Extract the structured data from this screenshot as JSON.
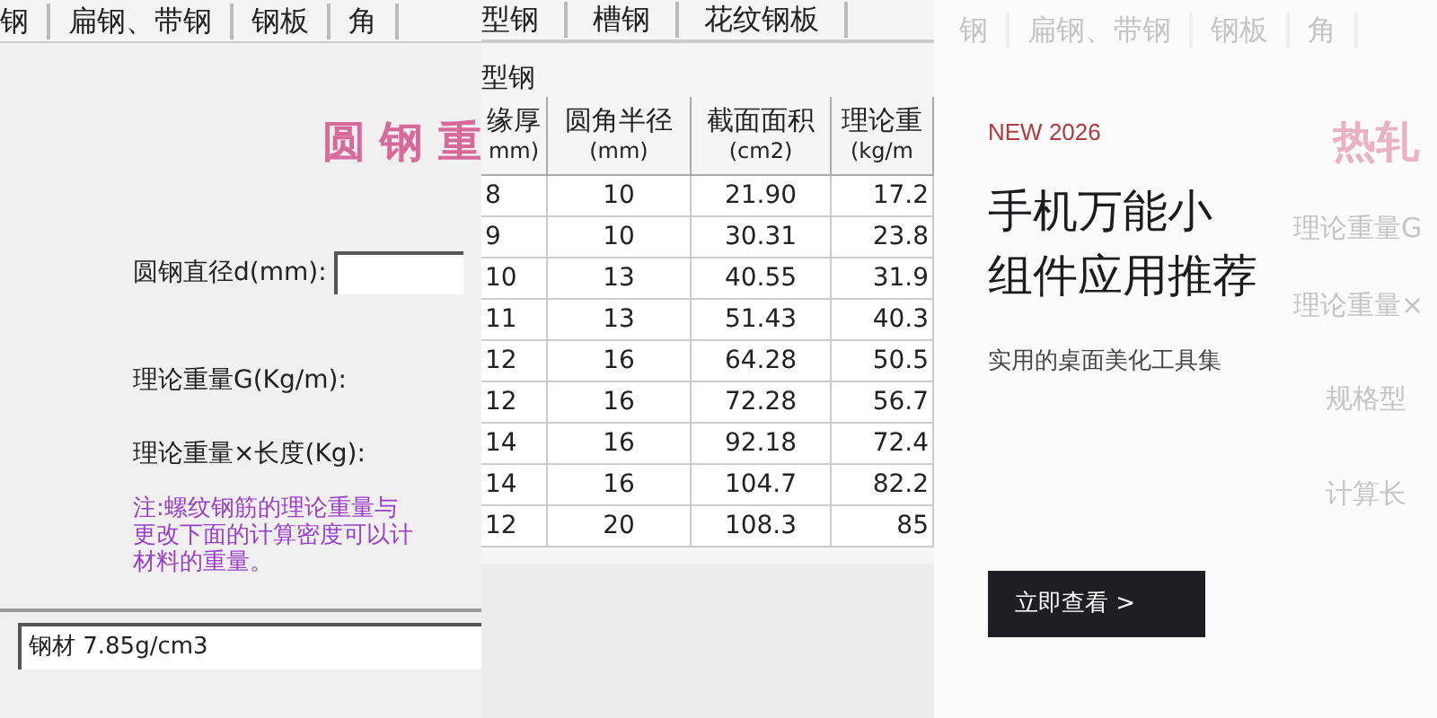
{
  "calculator": {
    "tabs": [
      "钢",
      "扁钢、带钢",
      "钢板",
      "角"
    ],
    "title": "圆 钢 重",
    "diameter_label": "圆钢直径d(mm):",
    "weight_label": "理论重量G(Kg/m):",
    "total_label": "理论重量×长度(Kg):",
    "note": [
      "注:螺纹钢筋的理论重量与",
      "更改下面的计算密度可以计",
      "材料的重量。"
    ],
    "density": "钢材 7.85g/cm3"
  },
  "table_panel": {
    "tabs": [
      "型钢",
      "槽钢",
      "花纹钢板"
    ],
    "section": "型钢",
    "columns": [
      {
        "name": "缘厚",
        "unit": "mm)"
      },
      {
        "name": "圆角半径",
        "unit": "(mm)"
      },
      {
        "name": "截面面积",
        "unit": "(cm2)"
      },
      {
        "name": "理论重",
        "unit": "(kg/m"
      }
    ],
    "rows": [
      [
        "8",
        "10",
        "21.90",
        "17.2"
      ],
      [
        "9",
        "10",
        "30.31",
        "23.8"
      ],
      [
        "10",
        "13",
        "40.55",
        "31.9"
      ],
      [
        "11",
        "13",
        "51.43",
        "40.3"
      ],
      [
        "12",
        "16",
        "64.28",
        "50.5"
      ],
      [
        "12",
        "16",
        "72.28",
        "56.7"
      ],
      [
        "14",
        "16",
        "92.18",
        "72.4"
      ],
      [
        "14",
        "16",
        "104.7",
        "82.2"
      ],
      [
        "12",
        "20",
        "108.3",
        "85"
      ]
    ]
  },
  "promo": {
    "faded": {
      "tabs": [
        "钢",
        "扁钢、带钢",
        "钢板",
        "角"
      ],
      "title": "热轧",
      "labels": [
        "理论重量G",
        "理论重量×",
        "规格型",
        "计算长"
      ]
    },
    "eyebrow": "NEW 2026",
    "headline": [
      "手机万能小",
      "组件应用推荐"
    ],
    "subtitle": "实用的桌面美化工具集",
    "button": "立即查看 >"
  }
}
